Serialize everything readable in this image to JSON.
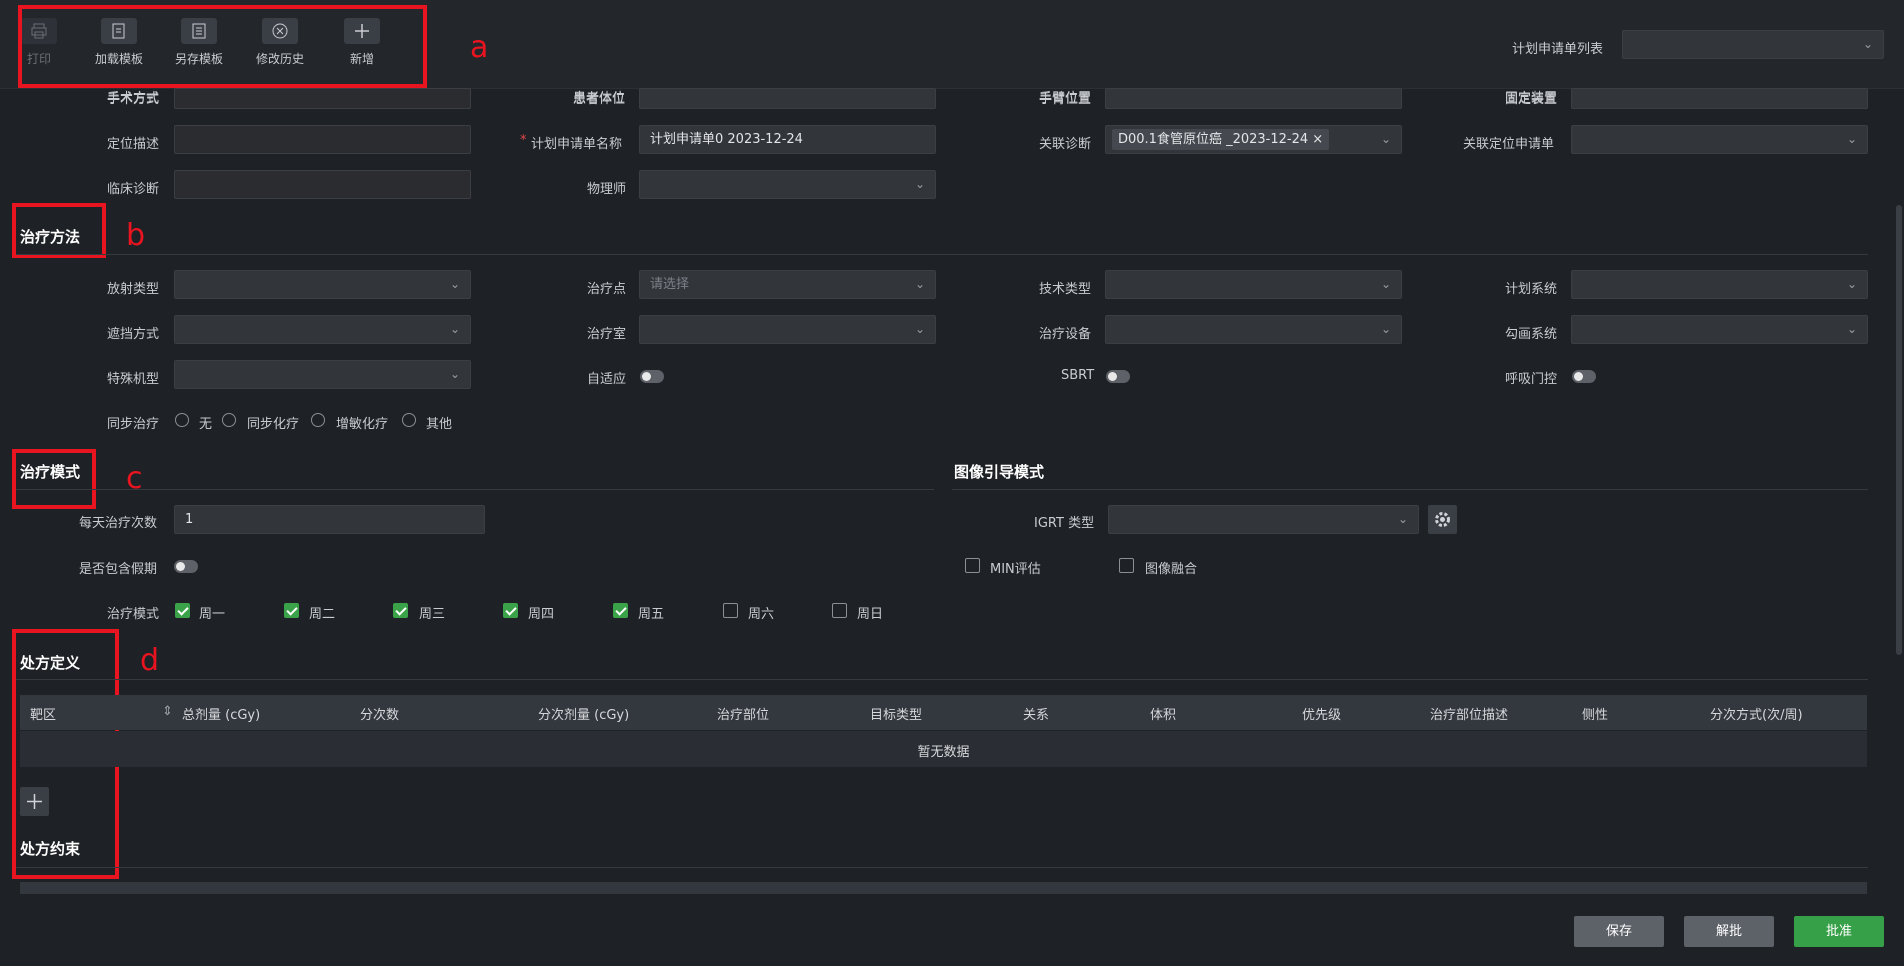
{
  "toolbar": {
    "buttons": [
      {
        "label": "打印",
        "icon": "printer-icon",
        "enabled": false
      },
      {
        "label": "加载模板",
        "icon": "load-template-icon",
        "enabled": true
      },
      {
        "label": "另存模板",
        "icon": "save-template-icon",
        "enabled": true
      },
      {
        "label": "修改历史",
        "icon": "history-icon",
        "enabled": true
      },
      {
        "label": "新增",
        "icon": "plus-icon",
        "enabled": true
      }
    ],
    "plan_list_label": "计划申请单列表",
    "plan_list_value": ""
  },
  "annotations": {
    "a": "a",
    "b": "b",
    "c": "c",
    "d": "d"
  },
  "basic": {
    "surgery_method": "手术方式",
    "patient_position": "患者体位",
    "arm_position": "手臂位置",
    "fixation_device": "固定装置",
    "positioning_desc": "定位描述",
    "plan_name_label": "计划申请单名称",
    "plan_name_value": "计划申请单0 2023-12-24",
    "required_mark": "*",
    "linked_diagnosis": "关联诊断",
    "linked_diagnosis_tag": "D00.1食管原位癌 _2023-12-24",
    "linked_positioning": "关联定位申请单",
    "clinical_diagnosis": "临床诊断",
    "physicist": "物理师"
  },
  "treatment_method": {
    "title": "治疗方法",
    "radiation_type": "放射类型",
    "treatment_point": "治疗点",
    "treatment_point_placeholder": "请选择",
    "technique_type": "技术类型",
    "planning_system": "计划系统",
    "blocking": "遮挡方式",
    "treatment_room": "治疗室",
    "treatment_device": "治疗设备",
    "contour_system": "勾画系统",
    "special_model": "特殊机型",
    "adaptive": "自适应",
    "sbrt": "SBRT",
    "breath_gating": "呼吸门控",
    "concurrent": "同步治疗",
    "concurrent_options": [
      "无",
      "同步化疗",
      "增敏化疗",
      "其他"
    ]
  },
  "treatment_mode": {
    "title": "治疗模式",
    "daily_count_label": "每天治疗次数",
    "daily_count_value": "1",
    "include_holiday": "是否包含假期",
    "mode_label": "治疗模式",
    "days": [
      {
        "label": "周一",
        "checked": true
      },
      {
        "label": "周二",
        "checked": true
      },
      {
        "label": "周三",
        "checked": true
      },
      {
        "label": "周四",
        "checked": true
      },
      {
        "label": "周五",
        "checked": true
      },
      {
        "label": "周六",
        "checked": false
      },
      {
        "label": "周日",
        "checked": false
      }
    ]
  },
  "igrt": {
    "title": "图像引导模式",
    "type_label": "IGRT 类型",
    "min_eval": "MIN评估",
    "image_fusion": "图像融合"
  },
  "prescription": {
    "title": "处方定义",
    "columns": [
      "靶区",
      "总剂量 (cGy)",
      "分次数",
      "分次剂量 (cGy)",
      "治疗部位",
      "目标类型",
      "关系",
      "体积",
      "优先级",
      "治疗部位描述",
      "侧性",
      "分次方式(次/周)"
    ],
    "empty_text": "暂无数据"
  },
  "constraint": {
    "title": "处方约束"
  },
  "footer": {
    "save": "保存",
    "unapprove": "解批",
    "approve": "批准"
  }
}
